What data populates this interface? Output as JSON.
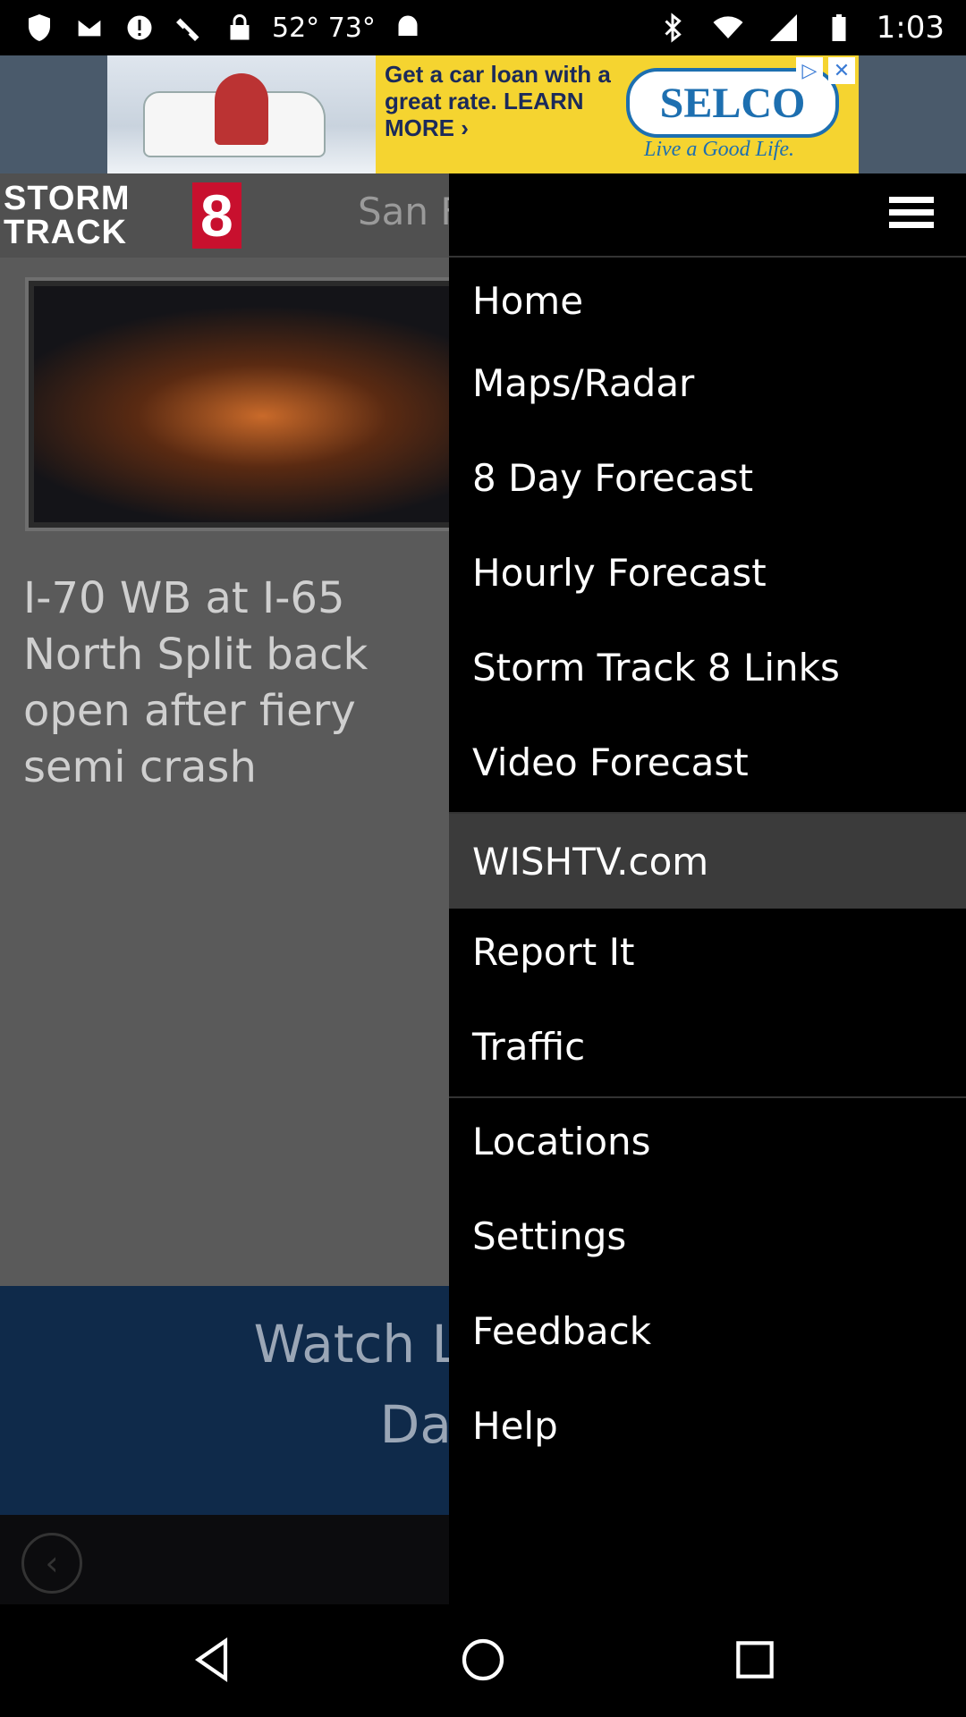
{
  "status_bar": {
    "temps": "52° 73°",
    "time": "1:03",
    "icons": [
      "shield-icon",
      "gmail-icon",
      "alert-icon",
      "satellite-icon",
      "lock-icon",
      "android-icon",
      "bluetooth-icon",
      "wifi-icon",
      "signal-icon",
      "battery-icon"
    ]
  },
  "ad": {
    "text": "Get a car loan with a great rate. LEARN MORE ›",
    "brand": "SELCO",
    "tagline": "Live a Good Life.",
    "controls": [
      "ad-choices-icon",
      "close-icon"
    ]
  },
  "header": {
    "logo_text": "STORM TRACK",
    "logo_number": "8",
    "city": "San F"
  },
  "article": {
    "headline": "I-70 WB at I-65 North Split back open after fiery semi crash"
  },
  "live": {
    "line1": "Watch Live: W",
    "line2": "Dayl"
  },
  "menu": {
    "items": [
      {
        "label": "Home",
        "selected": false
      },
      {
        "label": "Maps/Radar",
        "selected": false
      },
      {
        "label": "8 Day Forecast",
        "selected": false
      },
      {
        "label": "Hourly Forecast",
        "selected": false
      },
      {
        "label": "Storm Track 8 Links",
        "selected": false
      },
      {
        "label": "Video Forecast",
        "selected": false
      },
      {
        "label": "WISHTV.com",
        "selected": true
      },
      {
        "label": "Report It",
        "selected": false
      },
      {
        "label": "Traffic",
        "selected": false
      },
      {
        "label": "Locations",
        "selected": false
      },
      {
        "label": "Settings",
        "selected": false
      },
      {
        "label": "Feedback",
        "selected": false
      },
      {
        "label": "Help",
        "selected": false
      }
    ]
  },
  "colors": {
    "accent_red": "#c8102e",
    "drawer_bg": "#000000",
    "selected_bg": "#3b3b3b",
    "live_bar": "#0f2a4a"
  }
}
